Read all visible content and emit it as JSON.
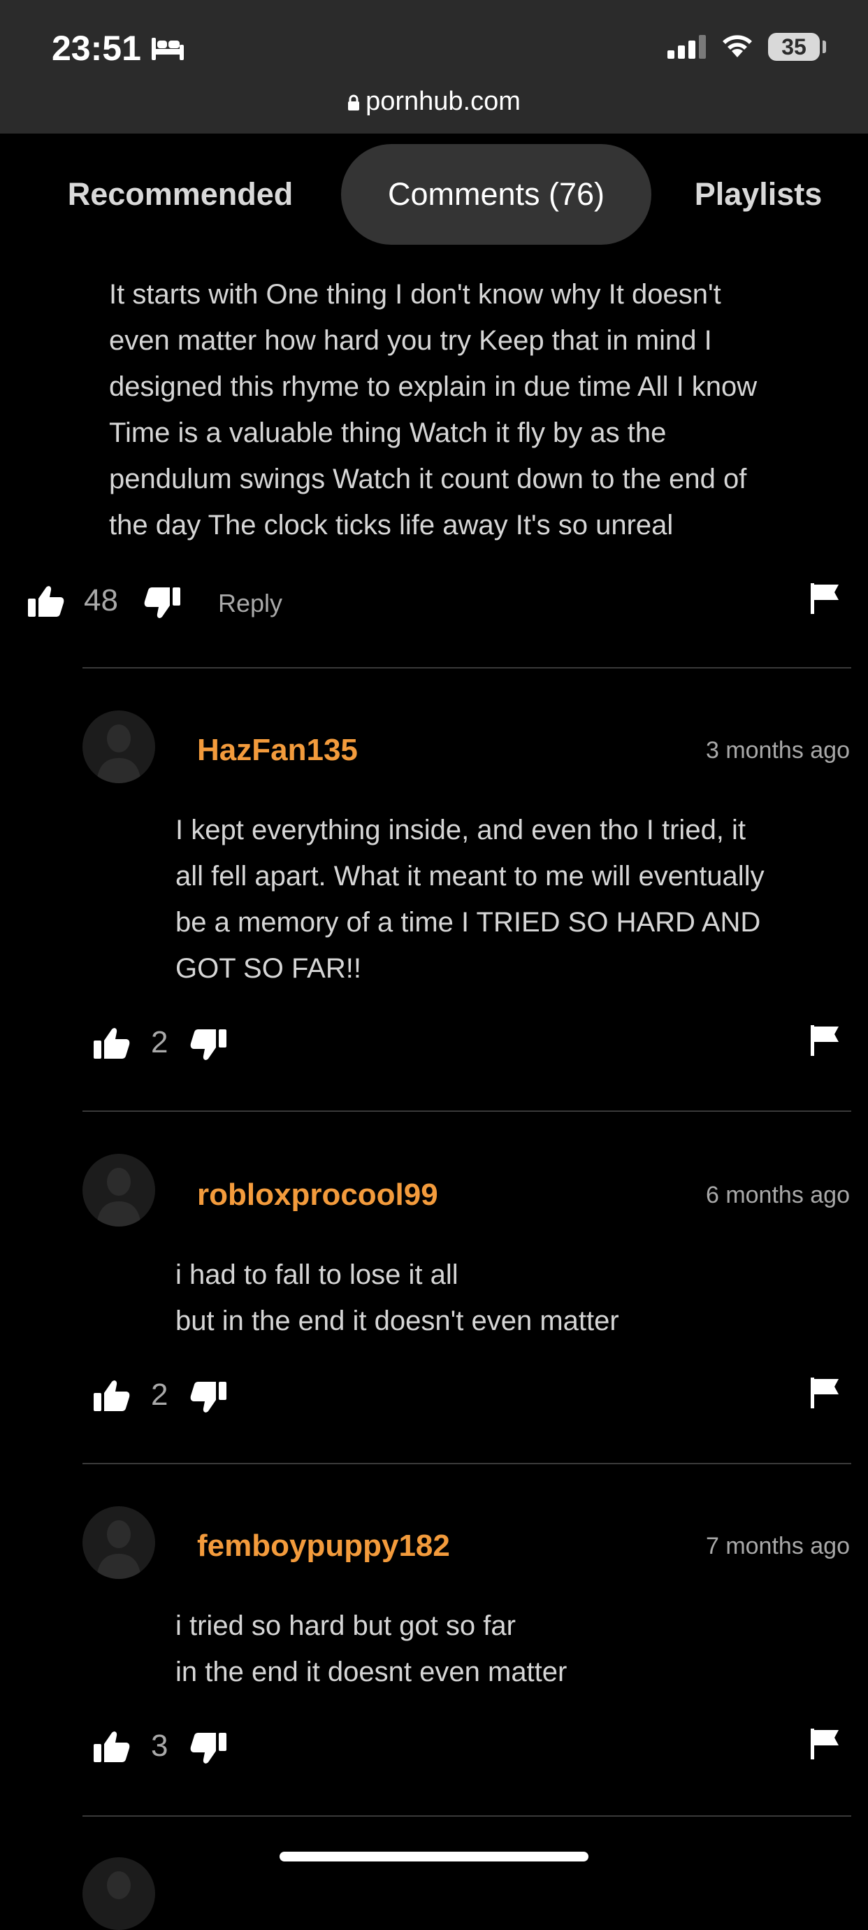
{
  "status_bar": {
    "time": "23:51",
    "battery": "35"
  },
  "url_bar": {
    "domain": "pornhub.com"
  },
  "tabs": [
    {
      "label": "Recommended",
      "active": false
    },
    {
      "label": "Comments (76)",
      "active": true
    },
    {
      "label": "Playlists",
      "active": false
    }
  ],
  "colors": {
    "accent_username": "#f39b3c",
    "background": "#000000",
    "topbar": "#2b2b2b"
  },
  "comments": [
    {
      "text": "It starts with One thing I don't know why It doesn't\neven matter how hard you try Keep that in mind I\ndesigned this rhyme to explain in due time All I know\nTime is a valuable thing Watch it fly by as the\npendulum swings Watch it count down to the end of\nthe day The clock ticks life away It's so unreal",
      "likes": "48",
      "reply_label": "Reply"
    },
    {
      "username": "HazFan135",
      "ago": "3 months ago",
      "text": "I kept everything inside, and even tho I tried, it\nall fell apart. What it meant to me will eventually\nbe a memory of a time I TRIED SO HARD AND\nGOT SO FAR!!",
      "likes": "2"
    },
    {
      "username": "robloxprocool99",
      "ago": "6 months ago",
      "text": "i had to fall to lose it all\nbut in the end it doesn't even matter",
      "likes": "2"
    },
    {
      "username": "femboypuppy182",
      "ago": "7 months ago",
      "text": "i tried so hard but got so far\nin the end it doesnt even matter",
      "likes": "3"
    }
  ]
}
